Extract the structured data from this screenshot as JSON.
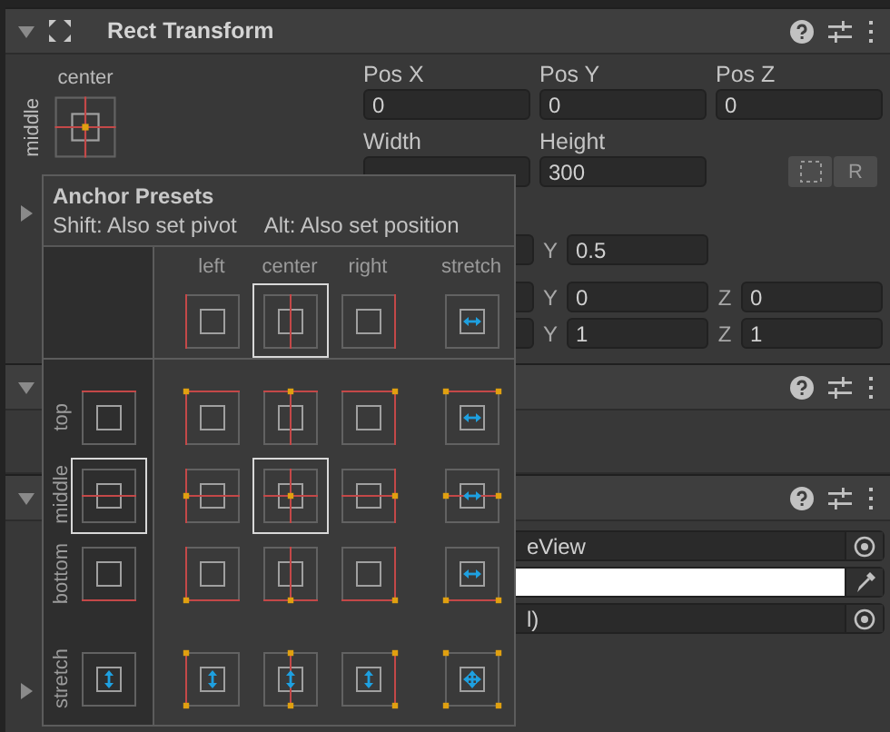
{
  "popup": {
    "title": "Anchor Presets",
    "hints": [
      "Shift: Also set pivot",
      "Alt: Also set position"
    ],
    "columns": [
      {
        "label": "left",
        "kind": "min",
        "selected": false
      },
      {
        "label": "center",
        "kind": "mid",
        "selected": true
      },
      {
        "label": "right",
        "kind": "max",
        "selected": false
      },
      {
        "label": "stretch",
        "kind": "fill",
        "selected": false
      }
    ],
    "rows": [
      {
        "label": "top",
        "kind": "min",
        "selected": false
      },
      {
        "label": "middle",
        "kind": "mid",
        "selected": true
      },
      {
        "label": "bottom",
        "kind": "max",
        "selected": false
      },
      {
        "label": "stretch",
        "kind": "fill",
        "selected": false
      }
    ]
  },
  "components": [
    {
      "kind": "rect_transform",
      "title": "Rect Transform",
      "expanded": true,
      "anchor": {
        "h_label": "center",
        "v_label": "middle"
      },
      "fields": [
        {
          "label": "Pos X",
          "value": "0"
        },
        {
          "label": "Pos Y",
          "value": "0"
        },
        {
          "label": "Pos Z",
          "value": "0"
        },
        {
          "label": "Width"
        },
        {
          "label": "Height",
          "value": "300"
        }
      ],
      "buttons": [
        {
          "kind": "blueprint"
        },
        {
          "kind": "text",
          "label": "R"
        }
      ],
      "foldout": {
        "expanded": false
      },
      "vector_rows": [
        {
          "parts": [
            {
              "label": "Y",
              "value": "0.5"
            }
          ]
        },
        {
          "parts": [
            {
              "label": "Y",
              "value": "0"
            },
            {
              "label": "Z",
              "value": "0"
            }
          ]
        },
        {
          "parts": [
            {
              "label": "Y",
              "value": "1"
            },
            {
              "label": "Z",
              "value": "1"
            }
          ]
        }
      ]
    },
    {
      "kind": "empty",
      "expanded": true
    },
    {
      "kind": "fields",
      "expanded": true,
      "rows": [
        {
          "kind": "object",
          "value": "eView"
        },
        {
          "kind": "color",
          "color": "#ffffff"
        },
        {
          "kind": "object",
          "value": "l)"
        }
      ],
      "foldout": {
        "expanded": false
      }
    }
  ]
}
